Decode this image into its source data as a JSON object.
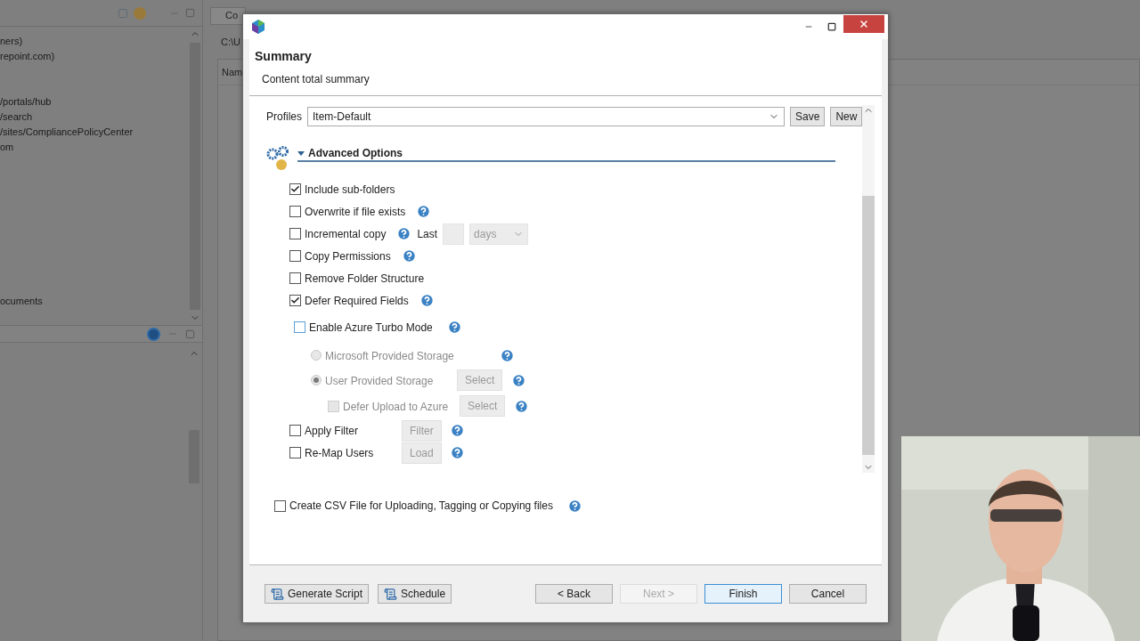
{
  "background": {
    "tree": {
      "groups": [
        [
          "ners)",
          "repoint.com)"
        ],
        [
          "/portals/hub",
          "/search",
          "/sites/CompliancePolicyCenter",
          "om"
        ],
        [
          "ocuments"
        ]
      ]
    },
    "editor_tab": "Co",
    "path": "C:\\U",
    "column_1": "Nam"
  },
  "dialog": {
    "header": {
      "title": "Summary",
      "subtitle": "Content total summary"
    },
    "profiles": {
      "label": "Profiles",
      "value": "Item-Default",
      "buttons": [
        "Save",
        "New"
      ]
    },
    "section": {
      "title": "Advanced Options",
      "expanded": true
    },
    "options": [
      {
        "kind": "checkbox",
        "label": "Include sub-folders",
        "checked": true,
        "disabled": false,
        "help": false
      },
      {
        "kind": "checkbox",
        "label": "Overwrite if file exists",
        "checked": false,
        "disabled": false,
        "help": true
      },
      {
        "kind": "incremental",
        "label": "Incremental copy",
        "checked": false,
        "disabled": false,
        "help": true,
        "last_label": "Last",
        "unit": "days"
      },
      {
        "kind": "checkbox",
        "label": "Copy Permissions",
        "checked": false,
        "disabled": false,
        "help": true
      },
      {
        "kind": "checkbox",
        "label": "Remove Folder Structure",
        "checked": false,
        "disabled": false,
        "help": false
      },
      {
        "kind": "checkbox",
        "label": "Defer Required Fields",
        "checked": true,
        "disabled": false,
        "help": true
      },
      {
        "kind": "toggle",
        "label": "Enable Azure Turbo Mode",
        "checked": false,
        "disabled": false,
        "help": true
      },
      {
        "kind": "radio",
        "label": "Microsoft Provided Storage",
        "selected": false,
        "disabled": true,
        "help": true
      },
      {
        "kind": "radio",
        "label": "User Provided Storage",
        "selected": true,
        "disabled": true,
        "help": true,
        "button": "Select"
      },
      {
        "kind": "subcheckbox",
        "label": "Defer Upload to Azure",
        "checked": false,
        "disabled": true,
        "help": true,
        "button": "Select"
      },
      {
        "kind": "checkbox",
        "label": "Apply Filter",
        "checked": false,
        "disabled": false,
        "help": true,
        "button": "Filter"
      },
      {
        "kind": "checkbox",
        "label": "Re-Map Users",
        "checked": false,
        "disabled": false,
        "help": true,
        "button": "Load"
      }
    ],
    "csv": {
      "label": "Create CSV File for Uploading, Tagging or Copying files",
      "checked": false
    },
    "footer": {
      "left": [
        "Generate Script",
        "Schedule"
      ],
      "right": [
        {
          "label": "< Back",
          "disabled": false,
          "default": false
        },
        {
          "label": "Next >",
          "disabled": true,
          "default": false
        },
        {
          "label": "Finish",
          "disabled": false,
          "default": true
        },
        {
          "label": "Cancel",
          "disabled": false,
          "default": false
        }
      ]
    }
  }
}
